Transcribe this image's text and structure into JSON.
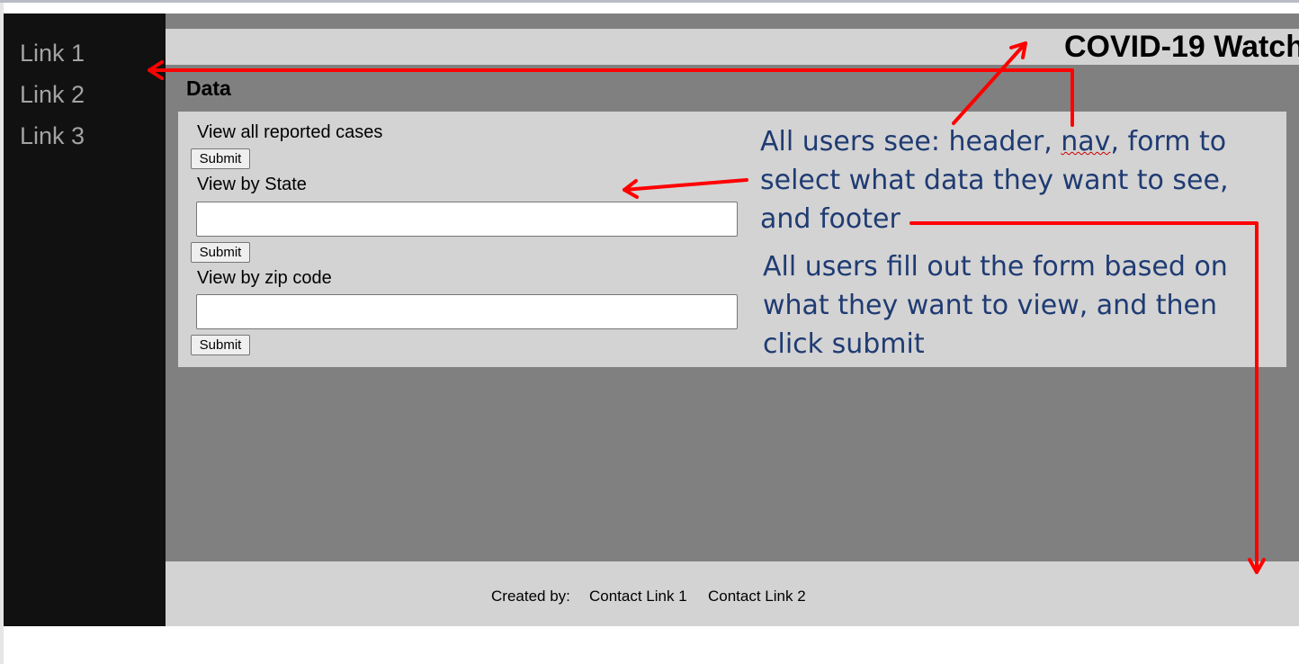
{
  "sidebar": {
    "links": [
      "Link 1",
      "Link 2",
      "Link 3"
    ]
  },
  "header": {
    "title": "COVID-19 Watch"
  },
  "main": {
    "heading": "Data",
    "form": {
      "all_cases_label": "View all reported cases",
      "state_label": "View by State",
      "zip_label": "View by zip code",
      "submit_label": "Submit",
      "state_value": "",
      "zip_value": ""
    }
  },
  "footer": {
    "created_by": "Created by:",
    "contact_link_1": "Contact Link 1",
    "contact_link_2": "Contact Link 2"
  },
  "annotations": {
    "note1": {
      "line1_pre": "All users see: header, ",
      "line1_nav": "nav",
      "line1_post": ",  form to",
      "line2": "select what data they want to see,",
      "line3": "and footer"
    },
    "note2": {
      "line1": "All users fill out the form based on",
      "line2": "what they want to view, and then",
      "line3": "click submit"
    }
  },
  "colors": {
    "sidebar_bg": "#111111",
    "main_bg": "#808080",
    "panel_bg": "#d3d3d3",
    "annotation_text": "#1f3b73",
    "arrow": "#ff0000"
  }
}
